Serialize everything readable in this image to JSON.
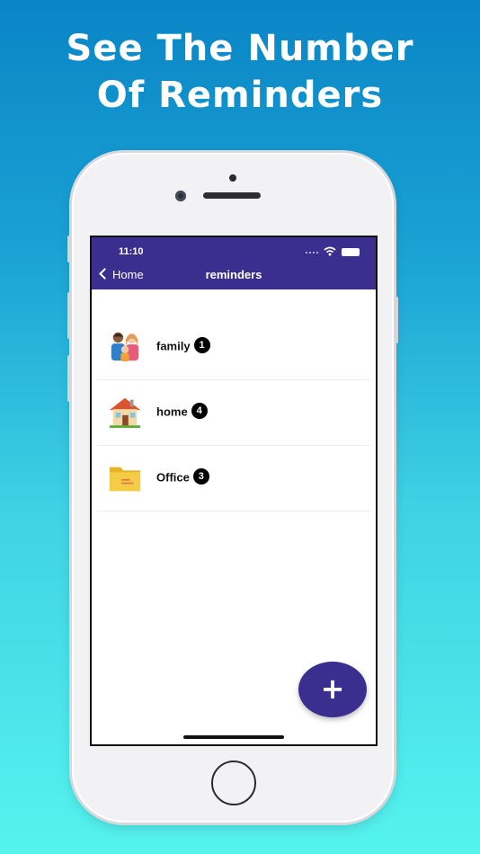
{
  "headline": {
    "line1": "See The Number",
    "line2": "Of Reminders"
  },
  "status_bar": {
    "time": "11:10"
  },
  "navbar": {
    "back_label": "Home",
    "title": "reminders",
    "color": "#3a2e8f"
  },
  "categories": [
    {
      "name": "family",
      "count": "1",
      "icon": "family-icon"
    },
    {
      "name": "home",
      "count": "4",
      "icon": "house-icon"
    },
    {
      "name": "Office",
      "count": "3",
      "icon": "folder-icon"
    }
  ],
  "fab": {
    "label": "+",
    "icon": "plus-icon"
  }
}
